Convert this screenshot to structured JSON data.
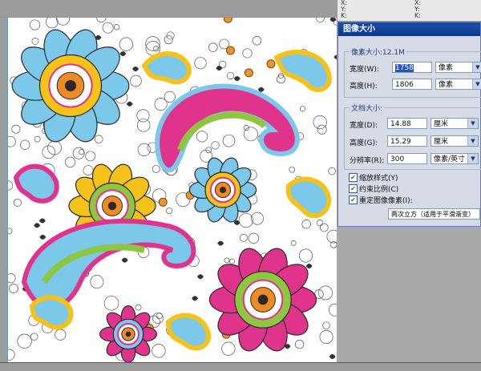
{
  "info_panel": {
    "left": [
      "X:",
      "Y:",
      "K:",
      "8位"
    ],
    "right": [
      "X:",
      "Y:",
      "K:",
      "8位"
    ]
  },
  "dialog": {
    "title": "图像大小",
    "pixel_group": {
      "label": "像素大小:12.1M",
      "width_label": "宽度(W):",
      "width_value": "1758",
      "width_unit": "像素",
      "height_label": "高度(H):",
      "height_value": "1806",
      "height_unit": "像素"
    },
    "doc_group": {
      "label": "文档大小:",
      "width_label": "宽度(D):",
      "width_value": "14.88",
      "width_unit": "厘米",
      "height_label": "高度(G):",
      "height_value": "15.29",
      "height_unit": "厘米",
      "res_label": "分辨率(R):",
      "res_value": "300",
      "res_unit": "像素/英寸"
    },
    "options": {
      "scale_styles": "缩放样式(Y)",
      "constrain": "约束比例(C)",
      "resample": "重定图像像素(I):"
    },
    "resample_method": "两次立方（适用于平滑渐变）"
  },
  "colors": {
    "magenta": "#e0348c",
    "sky": "#7cc8ea",
    "yellow": "#f5c21a",
    "green": "#8dc63f",
    "orange": "#f08a24",
    "dark": "#2a2a2a"
  }
}
